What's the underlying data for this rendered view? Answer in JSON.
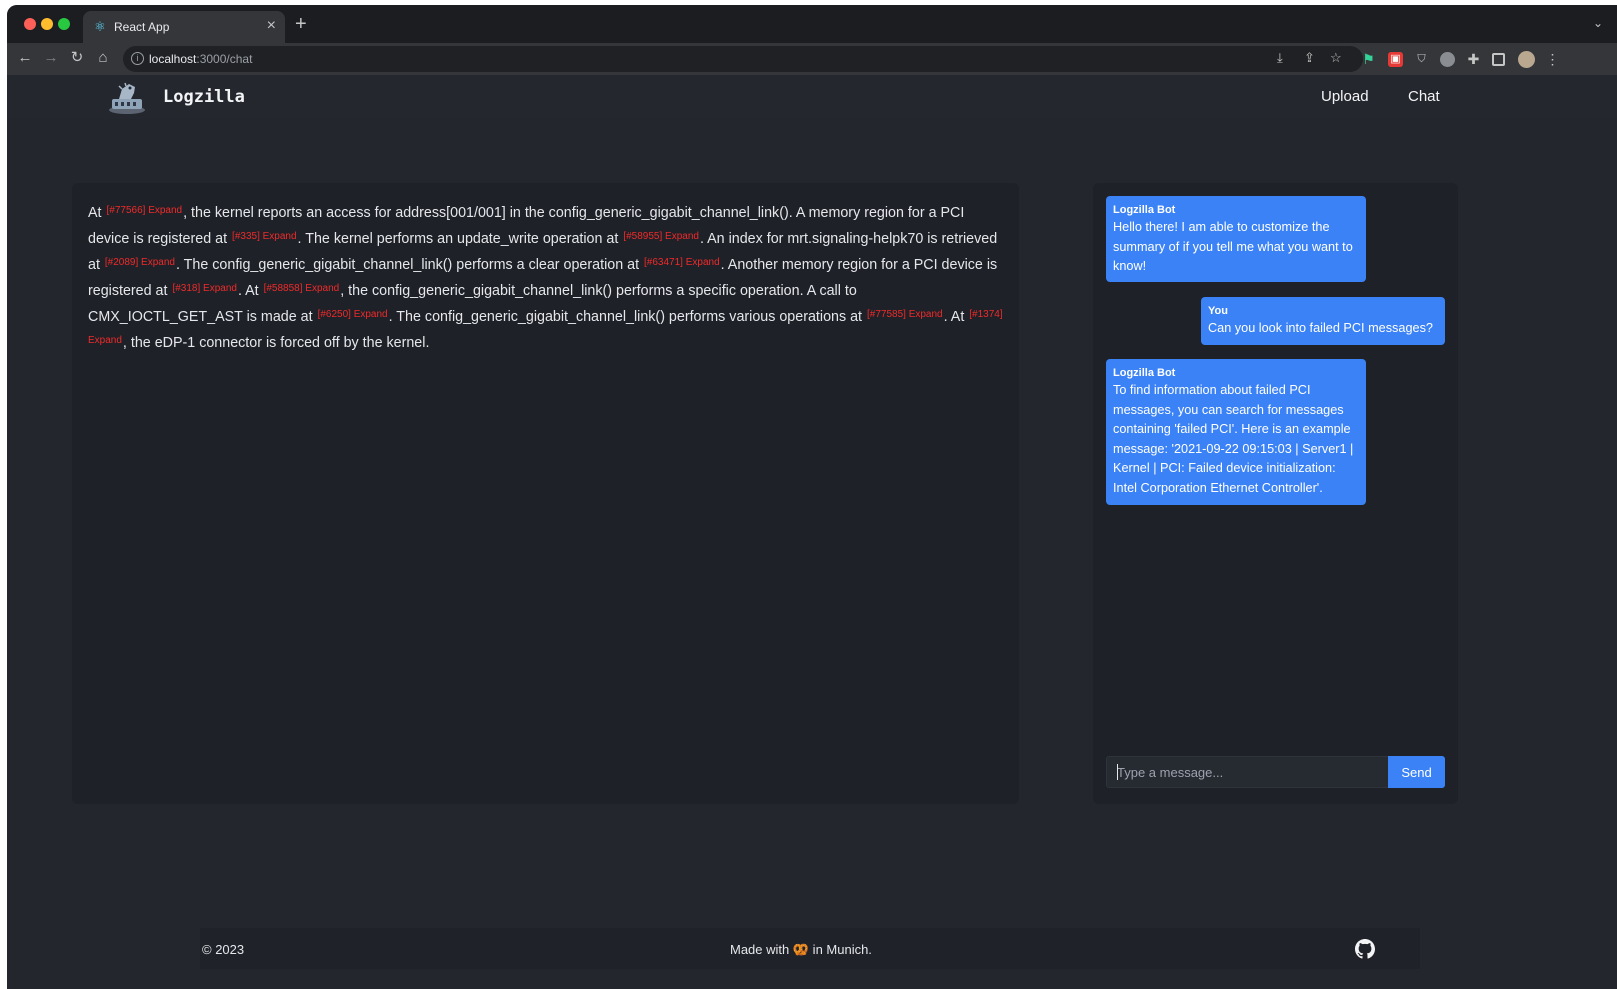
{
  "browser": {
    "tab_title": "React App",
    "url_host": "localhost",
    "url_path": ":3000/chat"
  },
  "app": {
    "brand": "Logzilla",
    "nav": {
      "upload": "Upload",
      "chat": "Chat"
    }
  },
  "summary": {
    "segments": [
      {
        "t": "At "
      },
      {
        "ref": "[#77566] Expand"
      },
      {
        "t": ", the kernel reports an access for address[001/001] in the config_generic_gigabit_channel_link(). A memory region for a PCI device is registered at "
      },
      {
        "ref": "[#335] Expand"
      },
      {
        "t": ". The kernel performs an update_write operation at "
      },
      {
        "ref": "[#58955] Expand"
      },
      {
        "t": ". An index for mrt.signaling-helpk70 is retrieved at "
      },
      {
        "ref": "[#2089] Expand"
      },
      {
        "t": ". The config_generic_gigabit_channel_link() performs a clear operation at "
      },
      {
        "ref": "[#63471] Expand"
      },
      {
        "t": ". Another memory region for a PCI device is registered at "
      },
      {
        "ref": "[#318] Expand"
      },
      {
        "t": ". At "
      },
      {
        "ref": "[#58858] Expand"
      },
      {
        "t": ", the config_generic_gigabit_channel_link() performs a specific operation. A call to CMX_IOCTL_GET_AST is made at "
      },
      {
        "ref": "[#6250] Expand"
      },
      {
        "t": ". The config_generic_gigabit_channel_link() performs various operations at "
      },
      {
        "ref": "[#77585] Expand"
      },
      {
        "t": ". At "
      },
      {
        "ref": "[#1374] Expand"
      },
      {
        "t": ", the eDP-1 connector is forced off by the kernel."
      }
    ]
  },
  "chat": {
    "messages": [
      {
        "sender": "Logzilla Bot",
        "text": "Hello there! I am able to customize the summary of if you tell me what you want to know!"
      },
      {
        "sender": "You",
        "text": "Can you look into failed PCI messages?"
      },
      {
        "sender": "Logzilla Bot",
        "text": "To find information about failed PCI messages, you can search for messages containing 'failed PCI'. Here is an example message: '2021-09-22 09:15:03 | Server1 | Kernel | PCI: Failed device initialization: Intel Corporation Ethernet Controller'."
      }
    ],
    "input_placeholder": "Type a message...",
    "send_label": "Send"
  },
  "footer": {
    "copyright": "© 2023",
    "made_prefix": "Made with ",
    "made_icon": "🥨",
    "made_suffix": " in Munich."
  },
  "colors": {
    "accent": "#3b82f6",
    "reference": "#ef2b2b",
    "background": "#23262d",
    "panel": "#1e2127"
  }
}
